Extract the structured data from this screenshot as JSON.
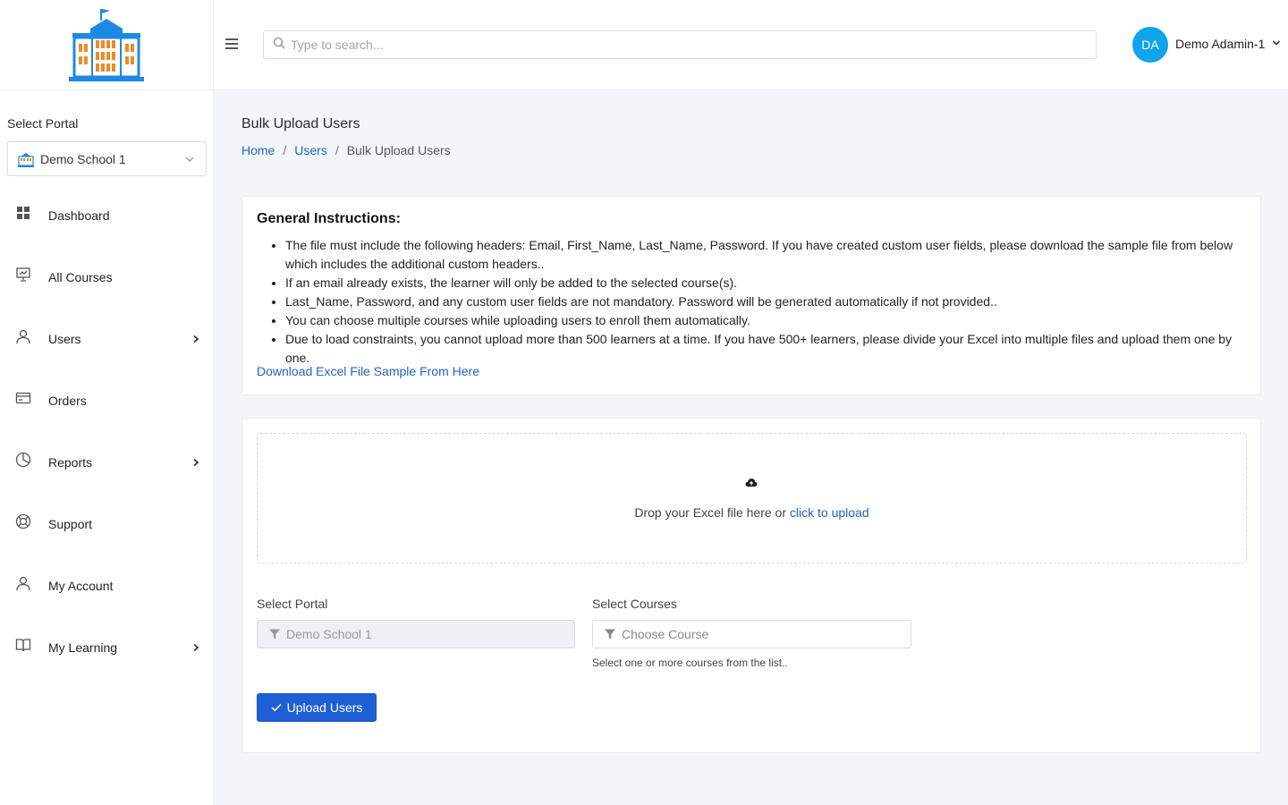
{
  "header": {
    "search_placeholder": "Type to search...",
    "user": {
      "initials": "DA",
      "name": "Demo Adamin-1",
      "avatar_color": "#0ea5ea"
    }
  },
  "sidebar": {
    "select_portal_label": "Select Portal",
    "selected_portal": "Demo School 1",
    "items": [
      {
        "label": "Dashboard",
        "icon": "dashboard-icon",
        "has_submenu": false
      },
      {
        "label": "All Courses",
        "icon": "presentation-icon",
        "has_submenu": false
      },
      {
        "label": "Users",
        "icon": "user-icon",
        "has_submenu": true
      },
      {
        "label": "Orders",
        "icon": "credit-card-icon",
        "has_submenu": false
      },
      {
        "label": "Reports",
        "icon": "pie-chart-icon",
        "has_submenu": true
      },
      {
        "label": "Support",
        "icon": "lifebuoy-icon",
        "has_submenu": false
      },
      {
        "label": "My Account",
        "icon": "user-icon",
        "has_submenu": false
      },
      {
        "label": "My Learning",
        "icon": "book-icon",
        "has_submenu": true
      }
    ]
  },
  "page": {
    "title": "Bulk Upload Users",
    "breadcrumb": {
      "home": "Home",
      "users": "Users",
      "current": "Bulk Upload Users"
    }
  },
  "instructions": {
    "title": "General Instructions:",
    "items": [
      "The file must include the following headers: Email, First_Name, Last_Name, Password. If you have created custom user fields, please download the sample file from below which includes the additional custom headers..",
      "If an email already exists, the learner will only be added to the selected course(s).",
      "Last_Name, Password, and any custom user fields are not mandatory. Password will be generated automatically if not provided..",
      "You can choose multiple courses while uploading users to enroll them automatically.",
      "Due to load constraints, you cannot upload more than 500 learners at a time. If you have 500+ learners, please divide your Excel into multiple files and upload them one by one."
    ],
    "download_link": "Download Excel File Sample From Here"
  },
  "upload": {
    "drop_text": "Drop your Excel file here or",
    "click_text": "click to upload",
    "portal_label": "Select Portal",
    "portal_value": "Demo School 1",
    "courses_label": "Select Courses",
    "courses_placeholder": "Choose Course",
    "courses_help": "Select one or more courses from the list..",
    "button_label": "Upload Users"
  },
  "colors": {
    "primary": "#1f5fd6",
    "link": "#2463c9",
    "brand_blue": "#1e88e5",
    "brand_orange": "#f08a24"
  }
}
